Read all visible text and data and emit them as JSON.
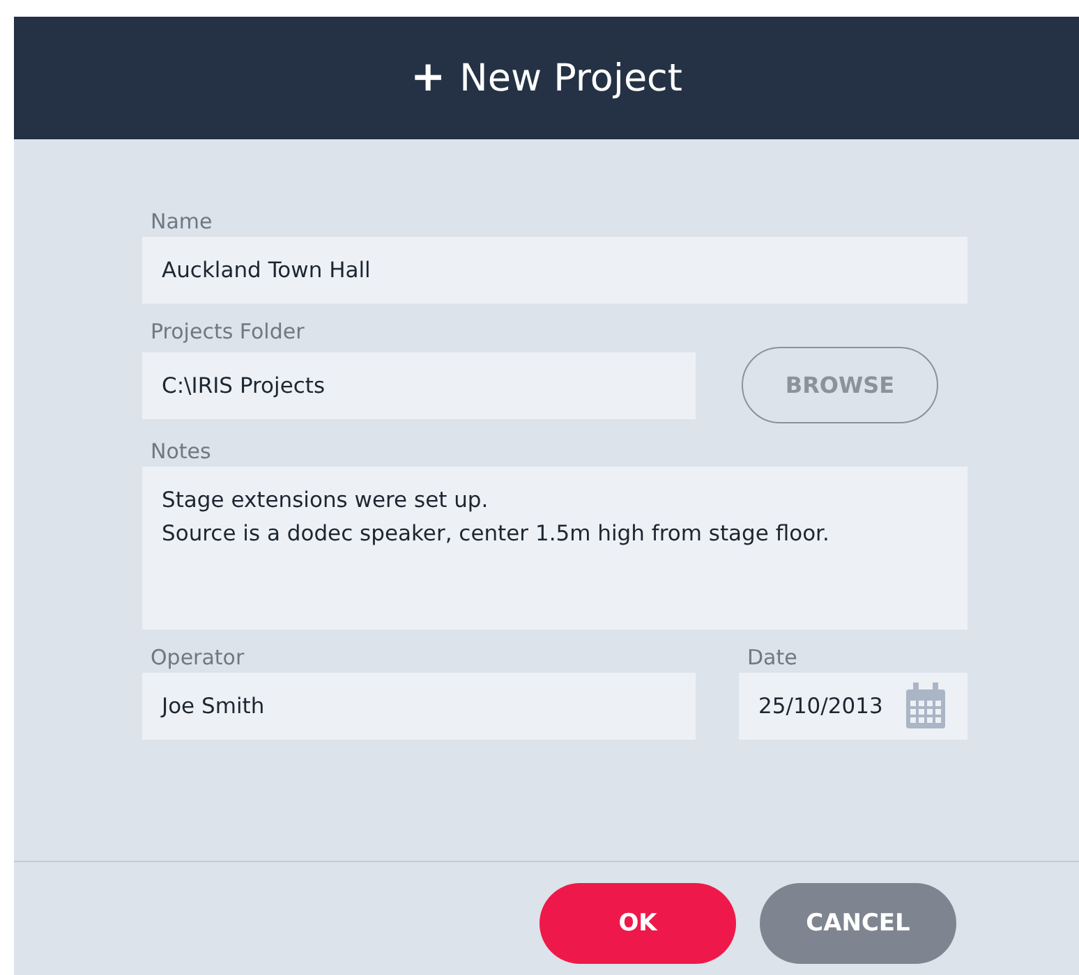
{
  "dialog": {
    "title": "New Project",
    "icon": "+"
  },
  "fields": [
    {
      "kind": "text",
      "label": "Name",
      "value": "Auckland Town Hall"
    },
    {
      "kind": "folder",
      "label": "Projects Folder",
      "value": "C:\\IRIS Projects",
      "button": "BROWSE"
    },
    {
      "kind": "multiline",
      "label": "Notes",
      "value": "Stage extensions were set up.\nSource is a dodec speaker, center 1.5m high from stage floor."
    }
  ],
  "operator": {
    "label": "Operator",
    "value": "Joe Smith"
  },
  "date": {
    "label": "Date",
    "value": "25/10/2013"
  },
  "buttons": [
    {
      "label": "OK",
      "kind": "primary"
    },
    {
      "label": "CANCEL",
      "kind": "secondary"
    }
  ]
}
